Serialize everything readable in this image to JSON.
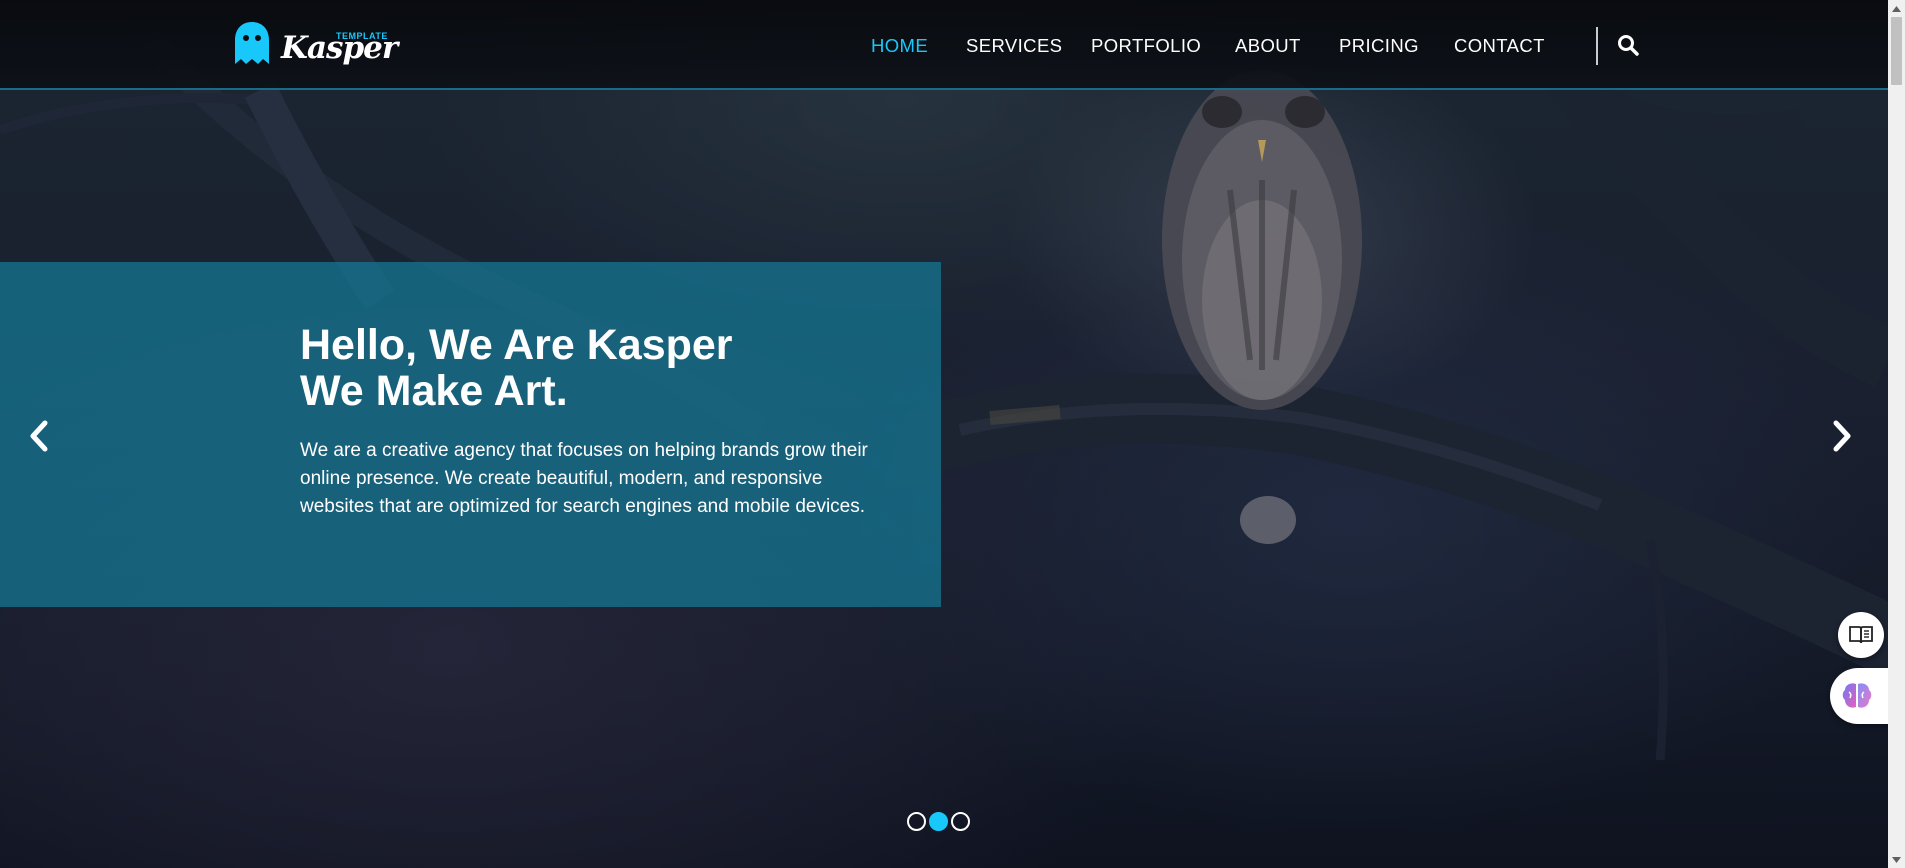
{
  "brand": {
    "logo_main": "Kasper",
    "logo_sub": "TEMPLATE",
    "logo_icon": "ghost-icon"
  },
  "nav": {
    "items": [
      {
        "label": "HOME",
        "active": true
      },
      {
        "label": "SERVICES",
        "active": false
      },
      {
        "label": "PORTFOLIO",
        "active": false
      },
      {
        "label": "ABOUT",
        "active": false
      },
      {
        "label": "PRICING",
        "active": false
      },
      {
        "label": "CONTACT",
        "active": false
      }
    ],
    "search_icon": "search-icon"
  },
  "slide": {
    "title_line1": "Hello, We Are Kasper",
    "title_line2": "We Make Art.",
    "description": "We are a creative agency that focuses on helping brands grow their online presence. We create beautiful, modern, and responsive websites that are optimized for search engines and mobile devices.",
    "prev_icon": "chevron-left-icon",
    "next_icon": "chevron-right-icon",
    "bullets_count": 3,
    "active_bullet": 2
  },
  "widgets": [
    {
      "icon": "book-icon"
    },
    {
      "icon": "brain-icon"
    }
  ],
  "colors": {
    "accent": "#19c8fa",
    "caption_bg": "#166f8b",
    "header_bg": "#0a0d12",
    "text": "#ffffff"
  }
}
